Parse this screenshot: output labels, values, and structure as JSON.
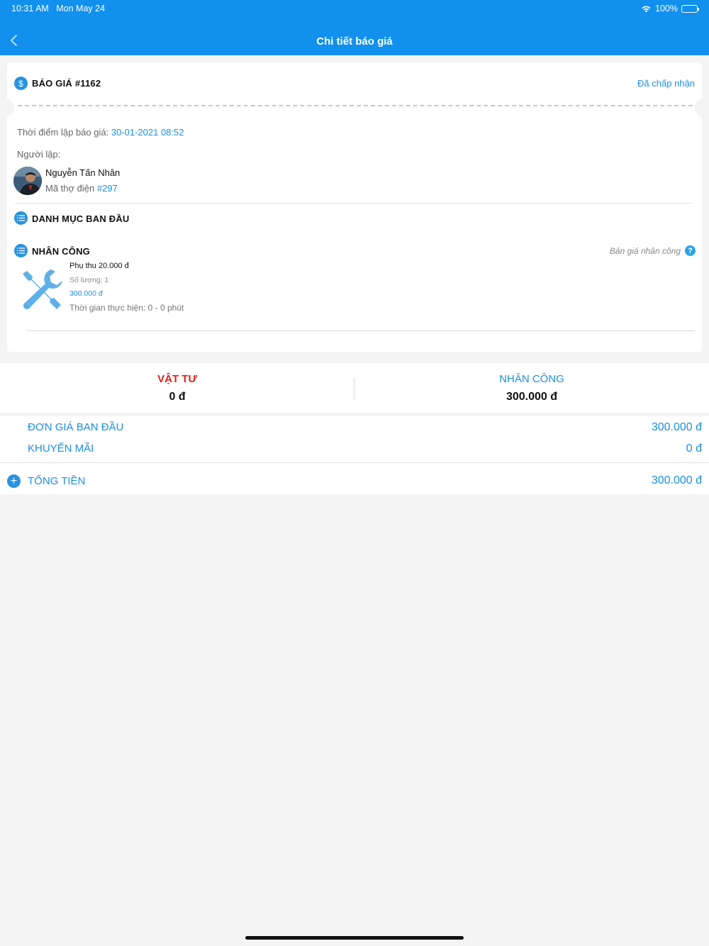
{
  "status_bar": {
    "time": "10:31 AM",
    "date": "Mon May 24",
    "battery": "100%"
  },
  "nav": {
    "title": "Chi tiết báo giá",
    "back_icon": "chevron-left-icon"
  },
  "quote": {
    "title": "BÁO GIÁ #1162",
    "status": "Đã chấp nhận",
    "created_label": "Thời điểm lập báo giá:",
    "created_value": "30-01-2021 08:52",
    "creator_label": "Người lập:",
    "creator_name": "Nguyễn Tấn Nhân",
    "creator_code_label": "Mã thợ điện",
    "creator_code": "#297"
  },
  "sections": {
    "initial_items": "DANH MỤC BAN ĐẦU",
    "labor": "NHÂN CÔNG",
    "labor_price_link": "Bản giá nhân công"
  },
  "labor_item": {
    "name": "Phụ thu 20.000 đ",
    "quantity": "Số lượng: 1",
    "price": "300.000 đ",
    "duration": "Thời gian thực hiện: 0 - 0 phút"
  },
  "summary": {
    "materials_label": "VẬT TƯ",
    "materials_value": "0 đ",
    "labor_label": "NHÂN CÔNG",
    "labor_value": "300.000 đ"
  },
  "totals": {
    "base_price_label": "ĐƠN GIÁ BAN ĐẦU",
    "base_price_value": "300.000 đ",
    "promo_label": "KHUYẾN MÃI",
    "promo_value": "0 đ",
    "total_label": "TỔNG TIỀN",
    "total_value": "300.000 đ"
  },
  "colors": {
    "primary": "#1190ee",
    "accent_blue": "#1a8fe3",
    "materials_red": "#e0201b",
    "background": "#f4f4f4"
  }
}
